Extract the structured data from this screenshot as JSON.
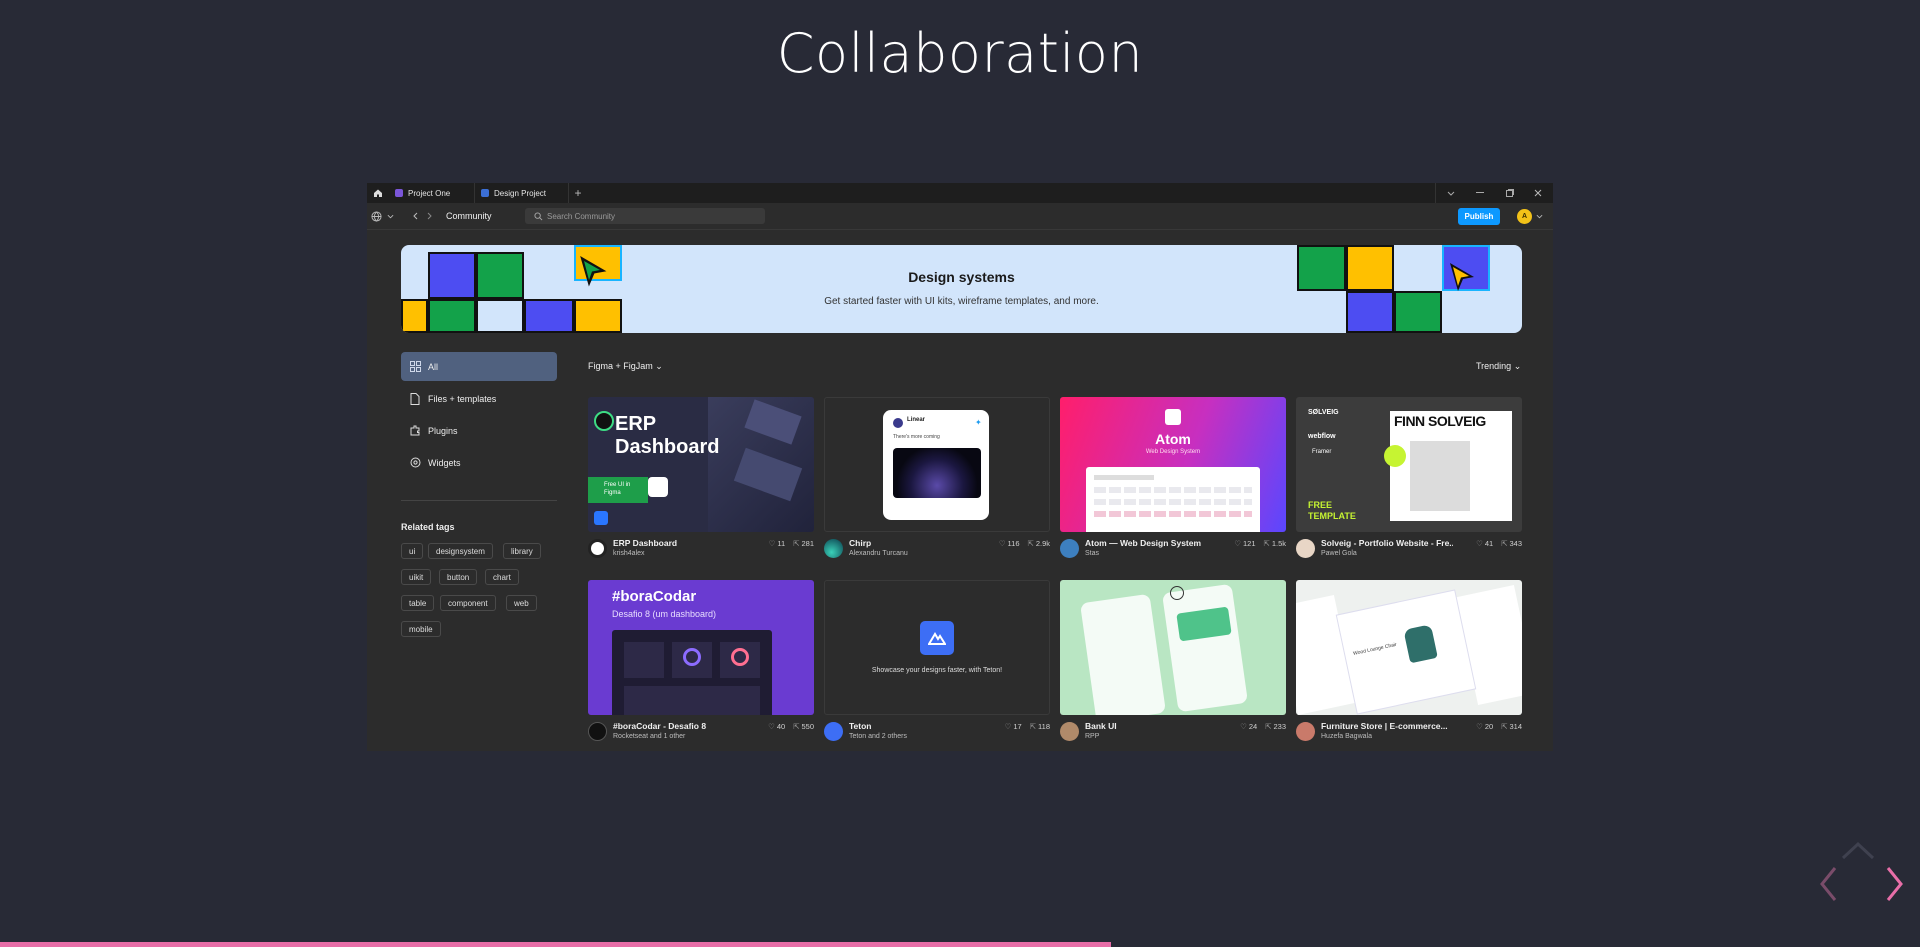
{
  "slide": {
    "title": "Collaboration"
  },
  "tabs": [
    {
      "label": "Project One",
      "color": "#7b56d9"
    },
    {
      "label": "Design Project",
      "color": "#3b6fd6"
    }
  ],
  "toolbar": {
    "breadcrumb": "Community",
    "search_placeholder": "Search Community",
    "publish_label": "Publish",
    "avatar_initial": "A"
  },
  "banner": {
    "title": "Design systems",
    "subtitle": "Get started faster with UI kits, wireframe templates, and more."
  },
  "sidebar": {
    "items": [
      {
        "label": "All",
        "icon": "grid-icon"
      },
      {
        "label": "Files + templates",
        "icon": "file-icon"
      },
      {
        "label": "Plugins",
        "icon": "plugin-icon"
      },
      {
        "label": "Widgets",
        "icon": "widget-icon"
      }
    ],
    "related_title": "Related tags",
    "tags": [
      "ui",
      "designsystem",
      "library",
      "uikit",
      "button",
      "chart",
      "table",
      "component",
      "web",
      "mobile"
    ]
  },
  "filters": {
    "left": "Figma + FigJam",
    "right": "Trending"
  },
  "cards": [
    {
      "name": "ERP Dashboard",
      "author": "krish4alex",
      "likes": "11",
      "dupes": "281",
      "thumb_title": "ERP Dashboard",
      "thumb_badge": "Free UI in Figma"
    },
    {
      "name": "Chirp",
      "author": "Alexandru Turcanu",
      "likes": "116",
      "dupes": "2.9k",
      "thumb_title": "Linear",
      "thumb_sub": "There's more coming"
    },
    {
      "name": "Atom — Web Design System",
      "author": "Stas",
      "likes": "121",
      "dupes": "1.5k",
      "thumb_title": "Atom",
      "thumb_sub": "Web Design System"
    },
    {
      "name": "Solveig - Portfolio Website - Fre...",
      "author": "Pawel Gola",
      "likes": "41",
      "dupes": "343",
      "thumb_title": "FINN SOLVEIG",
      "thumb_brand": "SØLVEIG",
      "thumb_tags": [
        "webflow",
        "Framer"
      ],
      "thumb_free": "FREE TEMPLATE"
    },
    {
      "name": "#boraCodar - Desafio 8",
      "author": "Rocketseat and 1 other",
      "likes": "40",
      "dupes": "550",
      "thumb_title": "#boraCodar",
      "thumb_sub": "Desafio 8 (um dashboard)"
    },
    {
      "name": "Teton",
      "author": "Teton and 2 others",
      "likes": "17",
      "dupes": "118",
      "thumb_sub": "Showcase your designs faster, with Teton!"
    },
    {
      "name": "Bank UI",
      "author": "RPP",
      "likes": "24",
      "dupes": "233"
    },
    {
      "name": "Furniture Store | E-commerce...",
      "author": "Huzefa Bagwala",
      "likes": "20",
      "dupes": "314",
      "thumb_title": "Wood Lounge Chair"
    }
  ],
  "colors": {
    "accent": "#0d99ff",
    "progress": "#e86ea8",
    "slide_bg": "#282a36"
  }
}
